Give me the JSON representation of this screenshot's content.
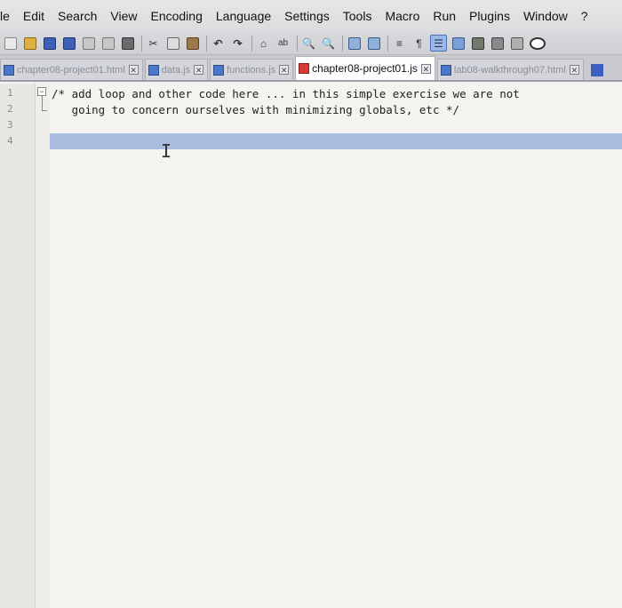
{
  "menubar": {
    "items": [
      "le",
      "Edit",
      "Search",
      "View",
      "Encoding",
      "Language",
      "Settings",
      "Tools",
      "Macro",
      "Run",
      "Plugins",
      "Window",
      "?"
    ]
  },
  "toolbar": {
    "icons": [
      "new-file-icon",
      "open-file-icon",
      "save-icon",
      "save-all-icon",
      "close-icon",
      "close-all-icon",
      "print-icon",
      "cut-icon",
      "copy-icon",
      "paste-icon",
      "undo-icon",
      "redo-icon",
      "find-icon",
      "replace-icon",
      "zoom-in-icon",
      "zoom-out-icon",
      "sync-v-icon",
      "sync-h-icon",
      "word-wrap-icon",
      "show-all-chars-icon",
      "indent-guide-icon",
      "doc-map-icon",
      "function-list-icon",
      "folder-icon",
      "macro-record-icon"
    ],
    "paragraph_glyph": "¶"
  },
  "tabs": [
    {
      "label": "chapter08-project01.html",
      "active": false
    },
    {
      "label": "data.js",
      "active": false
    },
    {
      "label": "functions.js",
      "active": false
    },
    {
      "label": "chapter08-project01.js",
      "active": true
    },
    {
      "label": "lab08-walkthrough07.html",
      "active": false
    }
  ],
  "editor": {
    "line_numbers": [
      "1",
      "2",
      "3",
      "4"
    ],
    "lines": [
      "/* add loop and other code here ... in this simple exercise we are not",
      "   going to concern ourselves with minimizing globals, etc */",
      "",
      ""
    ],
    "cursor_line": 4,
    "fold_marker": "−"
  },
  "colors": {
    "current_line": "#a8bde0",
    "active_tab_icon": "#d93a3a",
    "tab_icon": "#4a78c8"
  }
}
